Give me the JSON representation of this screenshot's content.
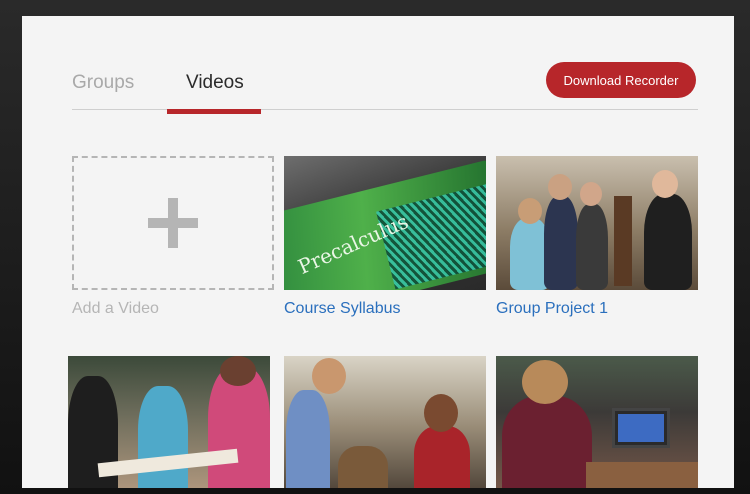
{
  "tabs": [
    {
      "label": "Groups",
      "active": false
    },
    {
      "label": "Videos",
      "active": true
    }
  ],
  "toolbar": {
    "download_label": "Download Recorder"
  },
  "colors": {
    "accent": "#b7262a",
    "link": "#2a6fbd",
    "muted": "#b5b5b5"
  },
  "videos": [
    {
      "caption": "Add a Video",
      "type": "add"
    },
    {
      "caption": "Course Syllabus",
      "thumb": "precalculus-book"
    },
    {
      "caption": "Group Project 1",
      "thumb": "classroom-group"
    },
    {
      "caption": "",
      "thumb": "students-writing"
    },
    {
      "caption": "",
      "thumb": "students-desk"
    },
    {
      "caption": "",
      "thumb": "student-laptop"
    }
  ],
  "thumb_text": {
    "book_title": "Precalculus"
  }
}
